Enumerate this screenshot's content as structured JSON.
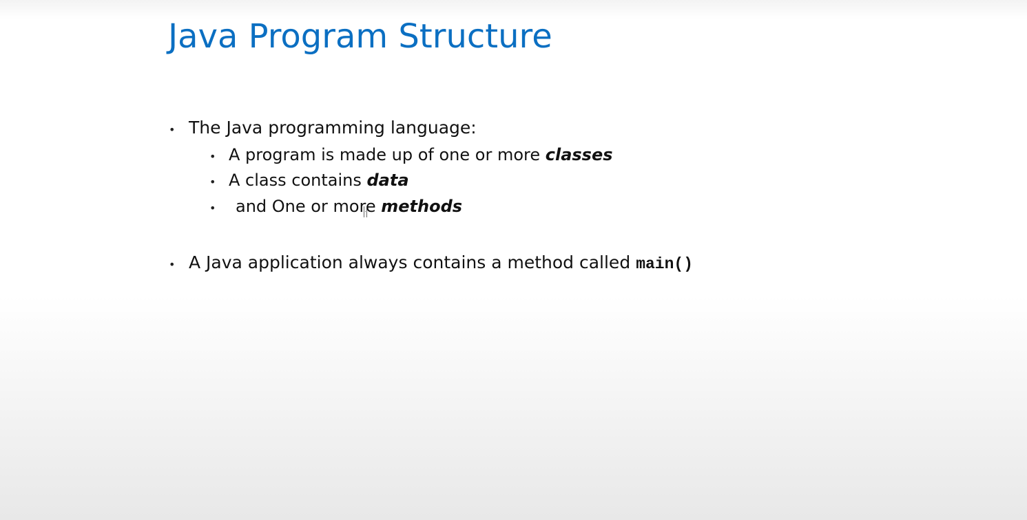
{
  "slide": {
    "title": "Java Program Structure",
    "bullet_glyph": "•",
    "bullets": [
      {
        "text": "The Java programming language:",
        "sub_bullets": [
          {
            "text": "A program is made up of one or more ",
            "emphasis": "classes"
          },
          {
            "text": "A class contains ",
            "emphasis": "data"
          },
          {
            "text": "and One or more ",
            "emphasis": "methods"
          }
        ]
      },
      {
        "text": "A Java application always contains a method called",
        "code": "main()"
      }
    ]
  }
}
